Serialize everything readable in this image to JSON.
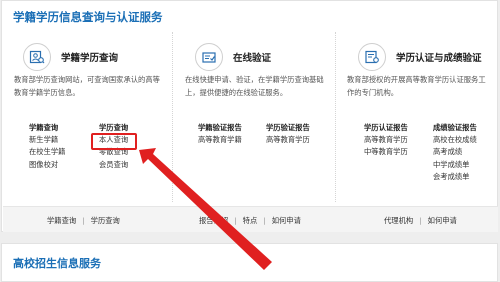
{
  "section1": {
    "title": "学籍学历信息查询与认证服务",
    "col1": {
      "title": "学籍学历查询",
      "desc": "教育部学历查询网站，可查询国家承认的高等教育学籍学历信息。",
      "links_left": {
        "head": "学籍查询",
        "items": [
          "新生学籍",
          "在校生学籍",
          "图像校对"
        ]
      },
      "links_right": {
        "head": "学历查询",
        "items": [
          "本人查询",
          "零散查询",
          "会员查询"
        ]
      },
      "footer": [
        "学籍查询",
        "学历查询"
      ]
    },
    "col2": {
      "title": "在线验证",
      "desc": "在线快捷申请、验证，在学籍学历查询基础上，提供便捷的在线验证服务。",
      "links_left": {
        "head": "学籍验证报告",
        "items": [
          "高等教育学籍"
        ]
      },
      "links_right": {
        "head": "学历验证报告",
        "items": [
          "高等教育学历"
        ]
      },
      "footer": [
        "报告介绍",
        "特点",
        "如何申请"
      ]
    },
    "col3": {
      "title": "学历认证与成绩验证",
      "desc": "教育部授权的开展高等教育学历认证服务工作的专门机构。",
      "links_left": {
        "head": "学历认证报告",
        "items": [
          "高等教育学历",
          "中等教育学历"
        ]
      },
      "links_right": {
        "head": "成绩验证报告",
        "items": [
          "高校在校成绩",
          "高考成绩",
          "中学成绩单",
          "会考成绩单"
        ]
      },
      "footer": [
        "代理机构",
        "如何申请"
      ]
    }
  },
  "section2": {
    "title": "高校招生信息服务"
  },
  "colors": {
    "accent": "#1b6fb6",
    "annotation": "#e02020"
  },
  "icons": {
    "col1": "id-card-icon",
    "col2": "verify-document-icon",
    "col3": "certificate-icon"
  }
}
